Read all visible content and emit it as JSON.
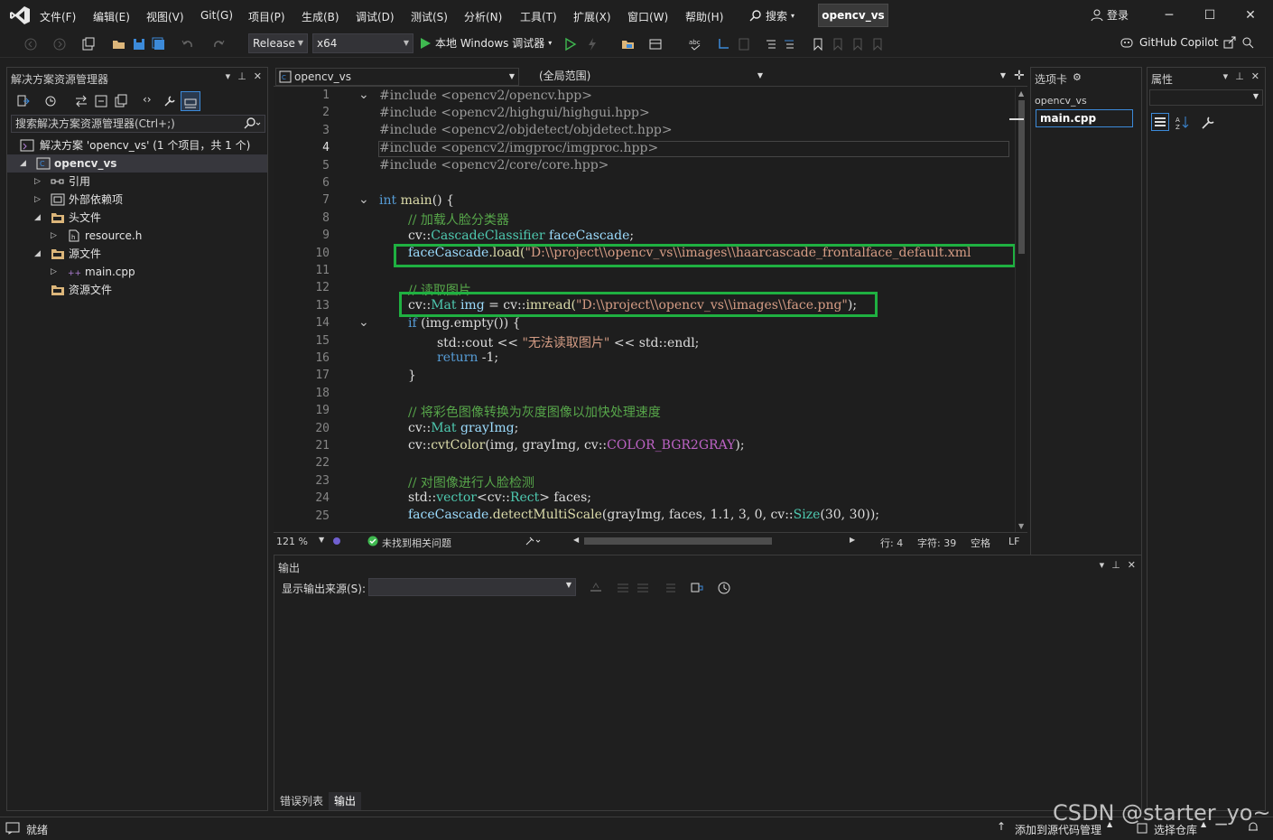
{
  "menu": {
    "items": [
      "文件(F)",
      "编辑(E)",
      "视图(V)",
      "Git(G)",
      "项目(P)",
      "生成(B)",
      "调试(D)",
      "测试(S)",
      "分析(N)",
      "工具(T)",
      "扩展(X)",
      "窗口(W)",
      "帮助(H)"
    ],
    "search_label": "搜索",
    "solution_name": "opencv_vs",
    "login_label": "登录"
  },
  "toolbar": {
    "configuration": "Release",
    "platform": "x64",
    "debugger_label": "本地 Windows 调试器",
    "copilot_label": "GitHub Copilot"
  },
  "solution_explorer": {
    "title": "解决方案资源管理器",
    "search_placeholder": "搜索解决方案资源管理器(Ctrl+;)",
    "solution_row": "解决方案 'opencv_vs' (1 个项目，共 1 个)",
    "tree": [
      {
        "label": "opencv_vs",
        "icon": "project-icon",
        "twisty": "expanded",
        "level": 1,
        "selected": true
      },
      {
        "label": "引用",
        "icon": "references-icon",
        "twisty": "collapsed",
        "level": 2
      },
      {
        "label": "外部依赖项",
        "icon": "external-deps-icon",
        "twisty": "collapsed",
        "level": 2
      },
      {
        "label": "头文件",
        "icon": "folder-icon",
        "twisty": "expanded",
        "level": 2
      },
      {
        "label": "resource.h",
        "icon": "header-file-icon",
        "twisty": "collapsed",
        "level": 3
      },
      {
        "label": "源文件",
        "icon": "folder-icon",
        "twisty": "expanded",
        "level": 2
      },
      {
        "label": "main.cpp",
        "icon": "cpp-file-icon",
        "twisty": "collapsed",
        "level": 3
      },
      {
        "label": "资源文件",
        "icon": "folder-icon",
        "twisty": "none",
        "level": 2
      }
    ]
  },
  "editor": {
    "project_dropdown": "opencv_vs",
    "scope_dropdown": "(全局范围)",
    "current_line": 4,
    "lines": [
      {
        "n": 1,
        "fold": "open"
      },
      {
        "n": 2
      },
      {
        "n": 3
      },
      {
        "n": 4
      },
      {
        "n": 5
      },
      {
        "n": 6
      },
      {
        "n": 7,
        "fold": "open"
      },
      {
        "n": 8
      },
      {
        "n": 9
      },
      {
        "n": 10
      },
      {
        "n": 11
      },
      {
        "n": 12
      },
      {
        "n": 13
      },
      {
        "n": 14,
        "fold": "open"
      },
      {
        "n": 15
      },
      {
        "n": 16
      },
      {
        "n": 17
      },
      {
        "n": 18
      },
      {
        "n": 19
      },
      {
        "n": 20
      },
      {
        "n": 21
      },
      {
        "n": 22
      },
      {
        "n": 23
      },
      {
        "n": 24
      },
      {
        "n": 25
      }
    ],
    "code": {
      "l1": "#include <opencv2/opencv.hpp>",
      "l2": "#include <opencv2/highgui/highgui.hpp>",
      "l3": "#include <opencv2/objdetect/objdetect.hpp>",
      "l4": "#include <opencv2/imgproc/imgproc.hpp>",
      "l5": "#include <opencv2/core/core.hpp>",
      "l7_kw": "int",
      "l7_fn": "main",
      "l7_rest": "() {",
      "l8": "// 加载人脸分类器",
      "l9_ns": "cv::",
      "l9_ty": "CascadeClassifier",
      "l9_var": "faceCascade",
      "l9_end": ";",
      "l10_var": "faceCascade",
      "l10_fn": ".load(",
      "l10_str": "\"D:\\\\project\\\\opencv_vs\\\\images\\\\haarcascade_frontalface_default.xml",
      "l12": "// 读取图片",
      "l13_ns": "cv::",
      "l13_ty": "Mat",
      "l13_var": "img",
      "l13_mid": " = cv::",
      "l13_fn": "imread(",
      "l13_str": "\"D:\\\\project\\\\opencv_vs\\\\images\\\\face.png\"",
      "l13_end": ");",
      "l14_kw": "if",
      "l14_rest": " (img.empty()) {",
      "l15_a": "std::cout << ",
      "l15_str": "\"无法读取图片\"",
      "l15_b": " << std::endl;",
      "l16_kw": "return",
      "l16_rest": " -1;",
      "l17": "}",
      "l19": "// 将彩色图像转换为灰度图像以加快处理速度",
      "l20_ns": "cv::",
      "l20_ty": "Mat",
      "l20_var": "grayImg",
      "l20_end": ";",
      "l21_a": "cv::",
      "l21_fn": "cvtColor",
      "l21_b": "(img, grayImg, cv::",
      "l21_mac": "COLOR_BGR2GRAY",
      "l21_c": ");",
      "l23": "// 对图像进行人脸检测",
      "l24_a": "std::",
      "l24_ty": "vector",
      "l24_b": "<cv::",
      "l24_ty2": "Rect",
      "l24_c": "> faces;",
      "l25_var": "faceCascade",
      "l25_fn": ".detectMultiScale",
      "l25_rest": "(grayImg, faces, 1.1, 3, 0, cv::",
      "l25_ty": "Size",
      "l25_end": "(30, 30));"
    }
  },
  "editor_status": {
    "zoom": "121 %",
    "issues": "未找到相关问题",
    "line": "行: 4",
    "char": "字符: 39",
    "whitespace": "空格",
    "eol": "LF"
  },
  "tabs_panel": {
    "title": "选项卡",
    "project": "opencv_vs",
    "active_file": "main.cpp"
  },
  "properties_panel": {
    "title": "属性"
  },
  "output_panel": {
    "title": "输出",
    "source_label": "显示输出来源(S):",
    "tabs": [
      "错误列表",
      "输出"
    ]
  },
  "statusbar": {
    "ready": "就绪",
    "add_source": "添加到源代码管理",
    "select_repo": "选择仓库"
  },
  "watermark": "CSDN @starter_yo~",
  "colors": {
    "highlight_box": "#1fb041",
    "keyword": "#569cd6",
    "comment": "#57a64a",
    "type": "#4ec9b0",
    "string": "#d69d85"
  }
}
